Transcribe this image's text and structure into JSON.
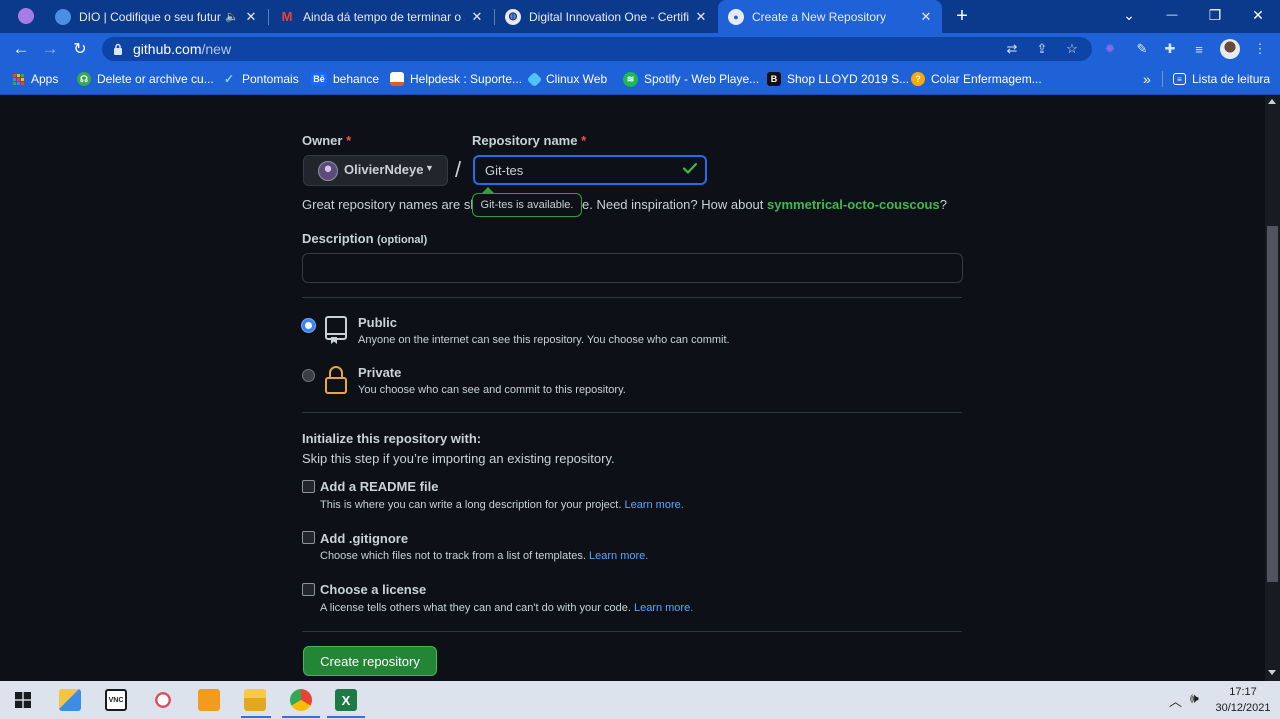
{
  "tabs": [
    {
      "title": "DIO | Codifique o seu futuro",
      "favicon_color": "#4a90e2"
    },
    {
      "title": "Ainda dá tempo de terminar o ar",
      "favicon_color": "#ea4335"
    },
    {
      "title": "Digital Innovation One - Certifica",
      "favicon_color": "#e8eaed"
    },
    {
      "title": "Create a New Repository",
      "favicon_color": "#e8eaed"
    }
  ],
  "new_tab": "+",
  "window_controls": {
    "dropdown": "⌄",
    "minimize": "—",
    "restore": "❐",
    "close": "✕"
  },
  "address_bar": {
    "domain": "github.com",
    "path": "/new"
  },
  "bookmarks": [
    {
      "label": "Apps",
      "color": "#ea4335"
    },
    {
      "label": "Delete or archive cu...",
      "color": "#34a853"
    },
    {
      "label": "Pontomais",
      "color": "#1a73e8"
    },
    {
      "label": "behance",
      "color": "#1769ff"
    },
    {
      "label": "Helpdesk : Suporte...",
      "color": "#fbbc04"
    },
    {
      "label": "Clinux Web",
      "color": "#4fc3f7"
    },
    {
      "label": "Spotify - Web Playe...",
      "color": "#1db954"
    },
    {
      "label": "Shop LLOYD 2019 S...",
      "color": "#111111"
    },
    {
      "label": "Colar Enfermagem...",
      "color": "#f9ab00"
    }
  ],
  "bookmarks_more": "»",
  "reading_list": "Lista de leitura",
  "form": {
    "owner_label": "Owner",
    "required_mark": "*",
    "owner_name": "OlivierNdeye",
    "slash": "/",
    "repo_label": "Repository name",
    "repo_value": "Git-tes",
    "availability": "Git-tes is available.",
    "hint_prefix": "Great repository names are sh",
    "hint_middle": "e. Need inspiration? How about",
    "hint_suggestion": "symmetrical-octo-couscous",
    "hint_suffix": "?",
    "description_label": "Description",
    "description_optional": "(optional)",
    "description_value": "",
    "visibility": {
      "public_title": "Public",
      "public_desc": "Anyone on the internet can see this repository. You choose who can commit.",
      "private_title": "Private",
      "private_desc": "You choose who can see and commit to this repository.",
      "selected": "public"
    },
    "init_title": "Initialize this repository with:",
    "init_subtitle": "Skip this step if you’re importing an existing repository.",
    "options": [
      {
        "title": "Add a README file",
        "desc": "This is where you can write a long description for your project.",
        "link": "Learn more."
      },
      {
        "title": "Add .gitignore",
        "desc": "Choose which files not to track from a list of templates.",
        "link": "Learn more."
      },
      {
        "title": "Choose a license",
        "desc": "A license tells others what they can and can't do with your code.",
        "link": "Learn more."
      }
    ],
    "create_button": "Create repository"
  },
  "taskbar": {
    "time": "17:17",
    "date": "30/12/2021"
  },
  "colors": {
    "accent": "#1f6feb",
    "success": "#238636",
    "link": "#58a6ff",
    "chrome": "#1f61d6"
  }
}
